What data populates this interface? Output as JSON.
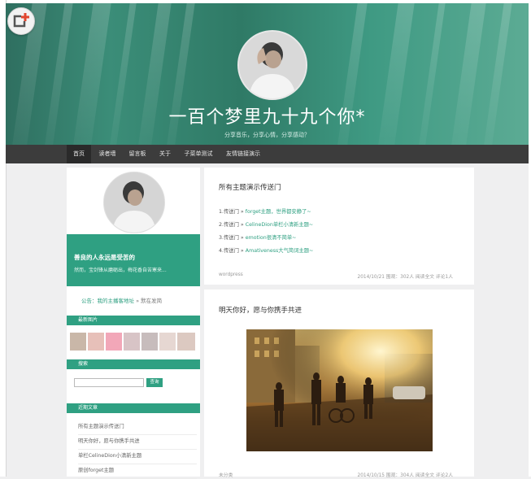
{
  "site": {
    "title": "一百个梦里九十九个你*",
    "subtitle": "分享音乐，分享心情，分享感动？"
  },
  "nav": {
    "items": [
      {
        "label": "首页",
        "active": true
      },
      {
        "label": "读者墙"
      },
      {
        "label": "留言板"
      },
      {
        "label": "关于"
      },
      {
        "label": "子菜单测试"
      },
      {
        "label": "友情链接演示"
      }
    ]
  },
  "sidebar": {
    "quote_title": "善良的人永远是受苦的",
    "quote_sub": "然而，宝剑锋从磨砺出，梅花香自苦寒来...",
    "notice_prefix": "公告：",
    "notice_link": "我的主播客地址",
    "notice_suffix": " » 默在发简",
    "latest_images_title": "最新图片",
    "search_title": "搜索",
    "search_button": "查询",
    "recent_title": "近期文章",
    "recent_posts": [
      "所有主题演示传送门",
      "明天你好，愿与你携手共进",
      "单栏CelineDion小清新主题",
      "原创forget主题"
    ]
  },
  "posts": [
    {
      "title": "所有主题演示传送门",
      "links": [
        {
          "prefix": "1.传送门 » ",
          "text": "forget主题，世界都安静了~"
        },
        {
          "prefix": "2.传送门 » ",
          "text": "CelineDion单栏小清新主题~"
        },
        {
          "prefix": "3.传送门 » ",
          "text": "emotion很清不简单~"
        },
        {
          "prefix": "4.传送门 » ",
          "text": "Amativeness大气简词主题~"
        }
      ],
      "category": "wordpress",
      "meta": "2014/10/21   围观：302人   阅读全文   评论1人"
    },
    {
      "title": "明天你好，愿与你携手共进",
      "category": "未分类",
      "meta": "2014/10/15   围观：304人   阅读全文   评论2人"
    }
  ],
  "colors": {
    "accent": "#2fa082",
    "nav_bg": "#3c3c3c",
    "page_bg": "#efeff0"
  },
  "icons": {
    "corner": "add-bookmark-icon"
  }
}
